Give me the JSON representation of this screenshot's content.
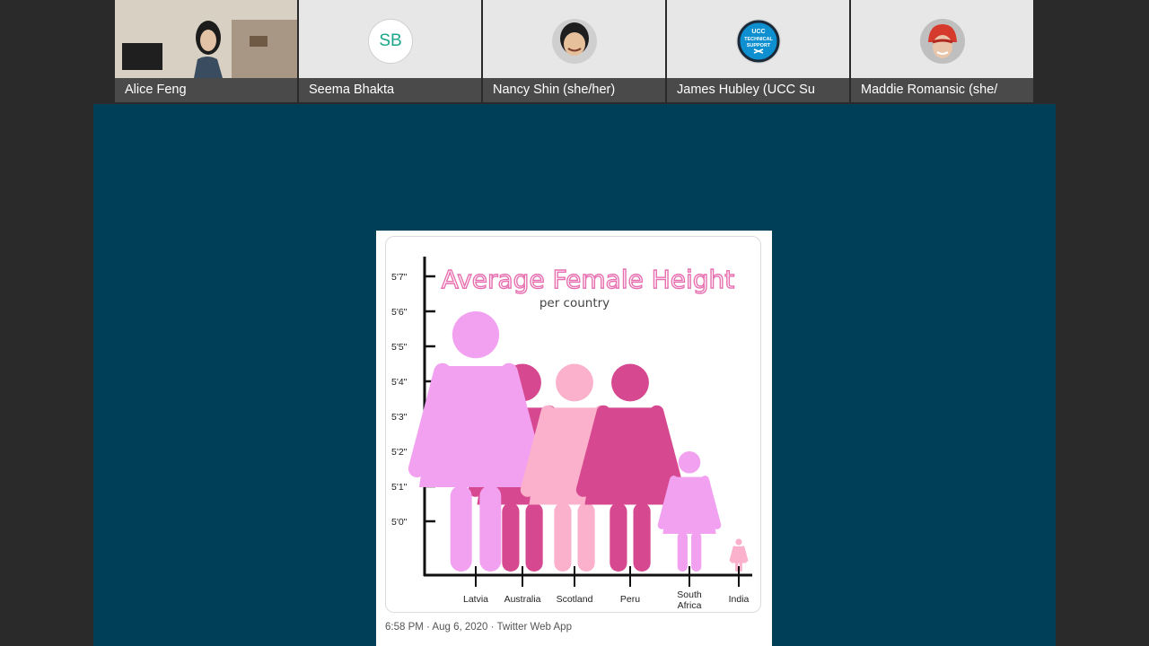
{
  "participants": [
    {
      "name": "Alice Feng",
      "kind": "video"
    },
    {
      "name": "Seema Bhakta",
      "kind": "initials",
      "initials": "SB"
    },
    {
      "name": "Nancy Shin (she/her)",
      "kind": "photo"
    },
    {
      "name": "James Hubley (UCC Su",
      "kind": "logo",
      "logo_text": [
        "UCC",
        "TECHNICAL",
        "SUPPORT"
      ]
    },
    {
      "name": "Maddie Romansic (she/",
      "kind": "photo"
    }
  ],
  "shared_content": {
    "tweet_meta": "6:58 PM · Aug 6, 2020 · Twitter Web App",
    "chart_data": {
      "type": "bar",
      "title": "Average Female Height",
      "subtitle": "per country",
      "y_ticks": [
        "5'0\"",
        "5'1\"",
        "5'2\"",
        "5'3\"",
        "5'4\"",
        "5'5\"",
        "5'6\"",
        "5'7\""
      ],
      "categories": [
        "Latvia",
        "Australia",
        "Scotland",
        "Peru",
        "South Africa",
        "India"
      ],
      "values_inches": [
        66.0,
        64.5,
        64.5,
        64.5,
        62.0,
        59.5
      ],
      "colors": [
        "#f2a1f0",
        "#d6488f",
        "#fbb1cc",
        "#d6488f",
        "#f2a1f0",
        "#fbb1cc"
      ]
    }
  },
  "colors": {
    "background": "#2a2a2a",
    "share_background": "#003f58",
    "name_bar": "#4a4a4a",
    "title_pink": "#e76fb0"
  }
}
